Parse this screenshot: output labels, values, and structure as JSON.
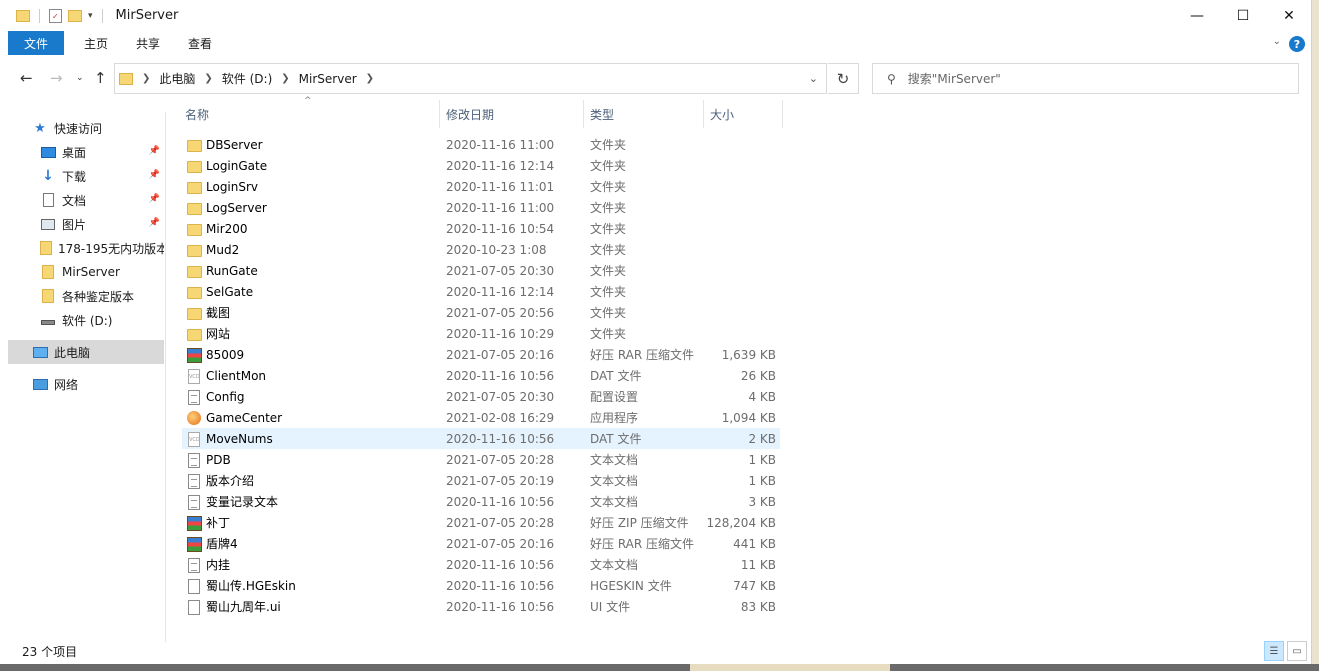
{
  "window": {
    "title": "MirServer",
    "controls": {
      "minimize": "—",
      "maximize": "☐",
      "close": "✕"
    }
  },
  "ribbon": {
    "tabs": [
      {
        "label": "文件",
        "active": true
      },
      {
        "label": "主页"
      },
      {
        "label": "共享"
      },
      {
        "label": "查看"
      }
    ],
    "help": "?"
  },
  "address": {
    "crumbs": [
      "此电脑",
      "软件 (D:)",
      "MirServer"
    ]
  },
  "search": {
    "placeholder": "搜索\"MirServer\""
  },
  "navpane": {
    "items": [
      {
        "label": "快速访问",
        "icon": "star-icon",
        "pinned": false
      },
      {
        "label": "桌面",
        "icon": "desktop-icon",
        "pinned": true
      },
      {
        "label": "下载",
        "icon": "download-icon",
        "pinned": true
      },
      {
        "label": "文档",
        "icon": "document-icon",
        "pinned": true
      },
      {
        "label": "图片",
        "icon": "pictures-icon",
        "pinned": true
      },
      {
        "label": "178-195无内功版本",
        "icon": "folder-icon",
        "pinned": false
      },
      {
        "label": "MirServer",
        "icon": "folder-icon",
        "pinned": false
      },
      {
        "label": "各种鉴定版本",
        "icon": "folder-icon",
        "pinned": false
      },
      {
        "label": "软件 (D:)",
        "icon": "drive-icon",
        "pinned": false
      },
      {
        "label": "此电脑",
        "icon": "this-pc-icon",
        "pinned": false,
        "selected": true
      },
      {
        "label": "网络",
        "icon": "network-icon",
        "pinned": false
      }
    ]
  },
  "columns": {
    "name": "名称",
    "date": "修改日期",
    "type": "类型",
    "size": "大小"
  },
  "files": [
    {
      "name": "DBServer",
      "date": "2020-11-16 11:00",
      "type": "文件夹",
      "size": "",
      "icon": "folder"
    },
    {
      "name": "LoginGate",
      "date": "2020-11-16 12:14",
      "type": "文件夹",
      "size": "",
      "icon": "folder"
    },
    {
      "name": "LoginSrv",
      "date": "2020-11-16 11:01",
      "type": "文件夹",
      "size": "",
      "icon": "folder"
    },
    {
      "name": "LogServer",
      "date": "2020-11-16 11:00",
      "type": "文件夹",
      "size": "",
      "icon": "folder"
    },
    {
      "name": "Mir200",
      "date": "2020-11-16 10:54",
      "type": "文件夹",
      "size": "",
      "icon": "folder"
    },
    {
      "name": "Mud2",
      "date": "2020-10-23 1:08",
      "type": "文件夹",
      "size": "",
      "icon": "folder"
    },
    {
      "name": "RunGate",
      "date": "2021-07-05 20:30",
      "type": "文件夹",
      "size": "",
      "icon": "folder"
    },
    {
      "name": "SelGate",
      "date": "2020-11-16 12:14",
      "type": "文件夹",
      "size": "",
      "icon": "folder"
    },
    {
      "name": "截图",
      "date": "2021-07-05 20:56",
      "type": "文件夹",
      "size": "",
      "icon": "folder"
    },
    {
      "name": "网站",
      "date": "2020-11-16 10:29",
      "type": "文件夹",
      "size": "",
      "icon": "folder"
    },
    {
      "name": "85009",
      "date": "2021-07-05 20:16",
      "type": "好压 RAR 压缩文件",
      "size": "1,639 KB",
      "icon": "rar"
    },
    {
      "name": "ClientMon",
      "date": "2020-11-16 10:56",
      "type": "DAT 文件",
      "size": "26 KB",
      "icon": "vcd"
    },
    {
      "name": "Config",
      "date": "2021-07-05 20:30",
      "type": "配置设置",
      "size": "4 KB",
      "icon": "doc"
    },
    {
      "name": "GameCenter",
      "date": "2021-02-08 16:29",
      "type": "应用程序",
      "size": "1,094 KB",
      "icon": "app"
    },
    {
      "name": "MoveNums",
      "date": "2020-11-16 10:56",
      "type": "DAT 文件",
      "size": "2 KB",
      "icon": "vcd",
      "hover": true
    },
    {
      "name": "PDB",
      "date": "2021-07-05 20:28",
      "type": "文本文档",
      "size": "1 KB",
      "icon": "doc"
    },
    {
      "name": "版本介绍",
      "date": "2021-07-05 20:19",
      "type": "文本文档",
      "size": "1 KB",
      "icon": "doc"
    },
    {
      "name": "变量记录文本",
      "date": "2020-11-16 10:56",
      "type": "文本文档",
      "size": "3 KB",
      "icon": "doc"
    },
    {
      "name": "补丁",
      "date": "2021-07-05 20:28",
      "type": "好压 ZIP 压缩文件",
      "size": "128,204 KB",
      "icon": "rar"
    },
    {
      "name": "盾牌4",
      "date": "2021-07-05 20:16",
      "type": "好压 RAR 压缩文件",
      "size": "441 KB",
      "icon": "rar"
    },
    {
      "name": "内挂",
      "date": "2020-11-16 10:56",
      "type": "文本文档",
      "size": "11 KB",
      "icon": "doc"
    },
    {
      "name": "蜀山传.HGEskin",
      "date": "2020-11-16 10:56",
      "type": "HGESKIN 文件",
      "size": "747 KB",
      "icon": "blank"
    },
    {
      "name": "蜀山九周年.ui",
      "date": "2020-11-16 10:56",
      "type": "UI 文件",
      "size": "83 KB",
      "icon": "blank"
    }
  ],
  "status": {
    "count": "23 个项目"
  }
}
